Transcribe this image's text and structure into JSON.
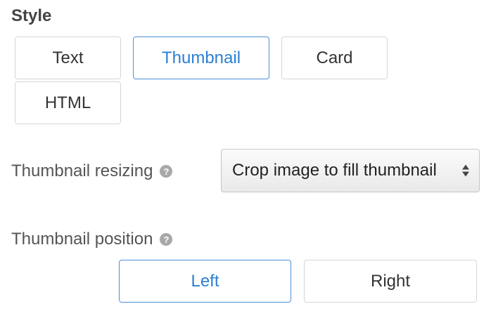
{
  "style_section": {
    "title": "Style",
    "options": {
      "text": "Text",
      "thumbnail": "Thumbnail",
      "card": "Card",
      "html": "HTML"
    },
    "selected": "Thumbnail"
  },
  "thumbnail_resizing": {
    "label": "Thumbnail resizing",
    "help_icon": "question-circle-icon",
    "selected_value": "Crop image to fill thumbnail"
  },
  "thumbnail_position": {
    "label": "Thumbnail position",
    "help_icon": "question-circle-icon",
    "options": {
      "left": "Left",
      "right": "Right"
    },
    "selected": "Left"
  },
  "colors": {
    "accent": "#2d7fd3",
    "border": "#d6d6d6"
  }
}
